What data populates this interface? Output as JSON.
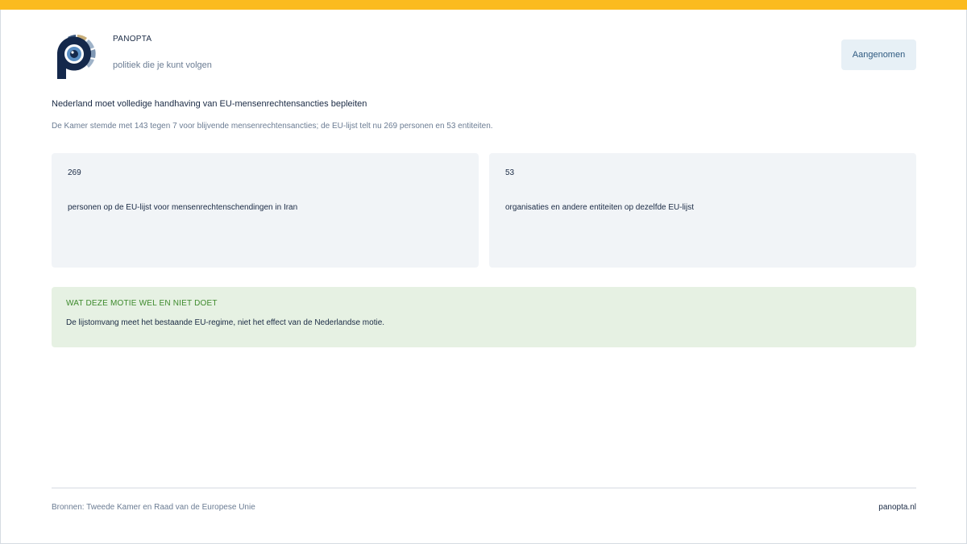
{
  "brand": {
    "name": "PANOPTA",
    "tagline": "politiek die je kunt volgen"
  },
  "status": {
    "label": "Aangenomen"
  },
  "article": {
    "headline": "Nederland moet volledige handhaving van EU-mensenrechtensancties bepleiten",
    "summary": "De Kamer stemde met 143 tegen 7 voor blijvende mensenrechtensancties; de EU-lijst telt nu 269 personen en 53 entiteiten."
  },
  "stats": [
    {
      "value": "269",
      "label": "personen op de EU-lijst voor mensenrechtenschendingen in Iran"
    },
    {
      "value": "53",
      "label": "organisaties en andere entiteiten op dezelfde EU-lijst"
    }
  ],
  "note": {
    "heading": "WAT DEZE MOTIE WEL EN NIET DOET",
    "body": "De lijstomvang meet het bestaande EU-regime, niet het effect van de Nederlandse motie."
  },
  "footer": {
    "sources": "Bronnen: Tweede Kamer en Raad van de Europese Unie",
    "site": "panopta.nl"
  },
  "colors": {
    "accent": "#fbbb1f",
    "navy": "#1a2a44",
    "note_bg": "#e6f1e3",
    "note_heading": "#3d8a2c"
  }
}
